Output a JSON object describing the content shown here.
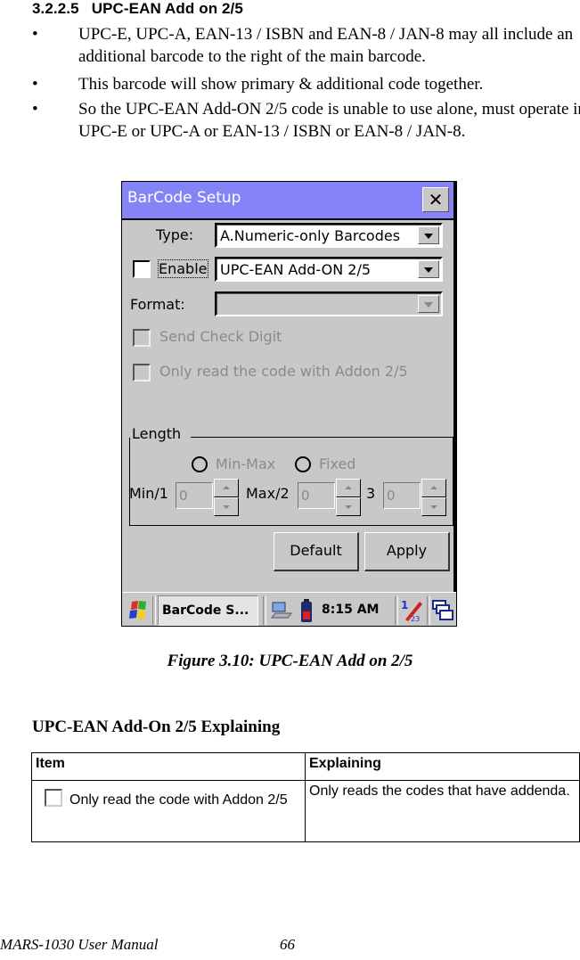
{
  "section": {
    "number": "3.2.2.5",
    "title": "UPC-EAN Add on 2/5"
  },
  "bullets": [
    {
      "symbol": "•",
      "text": "UPC-E, UPC-A, EAN-13 / ISBN and EAN-8 / JAN-8 may all include an additional barcode to the right of the main barcode."
    },
    {
      "symbol": "•",
      "text": "This barcode will show primary & additional code together."
    },
    {
      "symbol": "•",
      "text": "So the UPC-EAN Add-ON 2/5 code is unable to use alone, must operate in UPC-E or UPC-A or EAN-13 / ISBN or EAN-8 / JAN-8."
    }
  ],
  "window": {
    "title": "BarCode Setup",
    "close_icon": "close-x-icon",
    "type_label": "Type:",
    "type_value": "A.Numeric-only Barcodes",
    "enable_label": "Enable",
    "enable_checked": false,
    "symbology_value": "UPC-EAN Add-ON 2/5",
    "format_label": "Format:",
    "format_value": "",
    "send_check_digit_label": "Send Check Digit",
    "only_read_addon_label": "Only read the code with Addon 2/5",
    "length": {
      "legend": "Length",
      "radio_minmax": "Min-Max",
      "radio_fixed": "Fixed",
      "min_label": "Min/1",
      "min_value": "0",
      "max_label": "Max/2",
      "max_value": "0",
      "third_label": "3",
      "third_value": "0"
    },
    "default_button": "Default",
    "apply_button": "Apply"
  },
  "taskbar": {
    "start_icon": "windows-flag-icon",
    "task_label": "BarCode S...",
    "network_icon": "network-computer-icon",
    "battery_icon": "battery-icon",
    "time": "8:15 AM",
    "input_icon": "pen-input-icon",
    "windows_icon": "cascade-windows-icon"
  },
  "figure_caption": "Figure 3.10: UPC-EAN Add on 2/5",
  "explaining": {
    "heading": "UPC-EAN Add-On 2/5 Explaining",
    "columns": [
      "Item",
      "Explaining"
    ],
    "rows": [
      {
        "item": "Only read the code with Addon 2/5",
        "explaining": "Only reads the codes that have addenda."
      }
    ]
  },
  "footer": {
    "manual": "MARS-1030 User Manual",
    "page": "66"
  }
}
